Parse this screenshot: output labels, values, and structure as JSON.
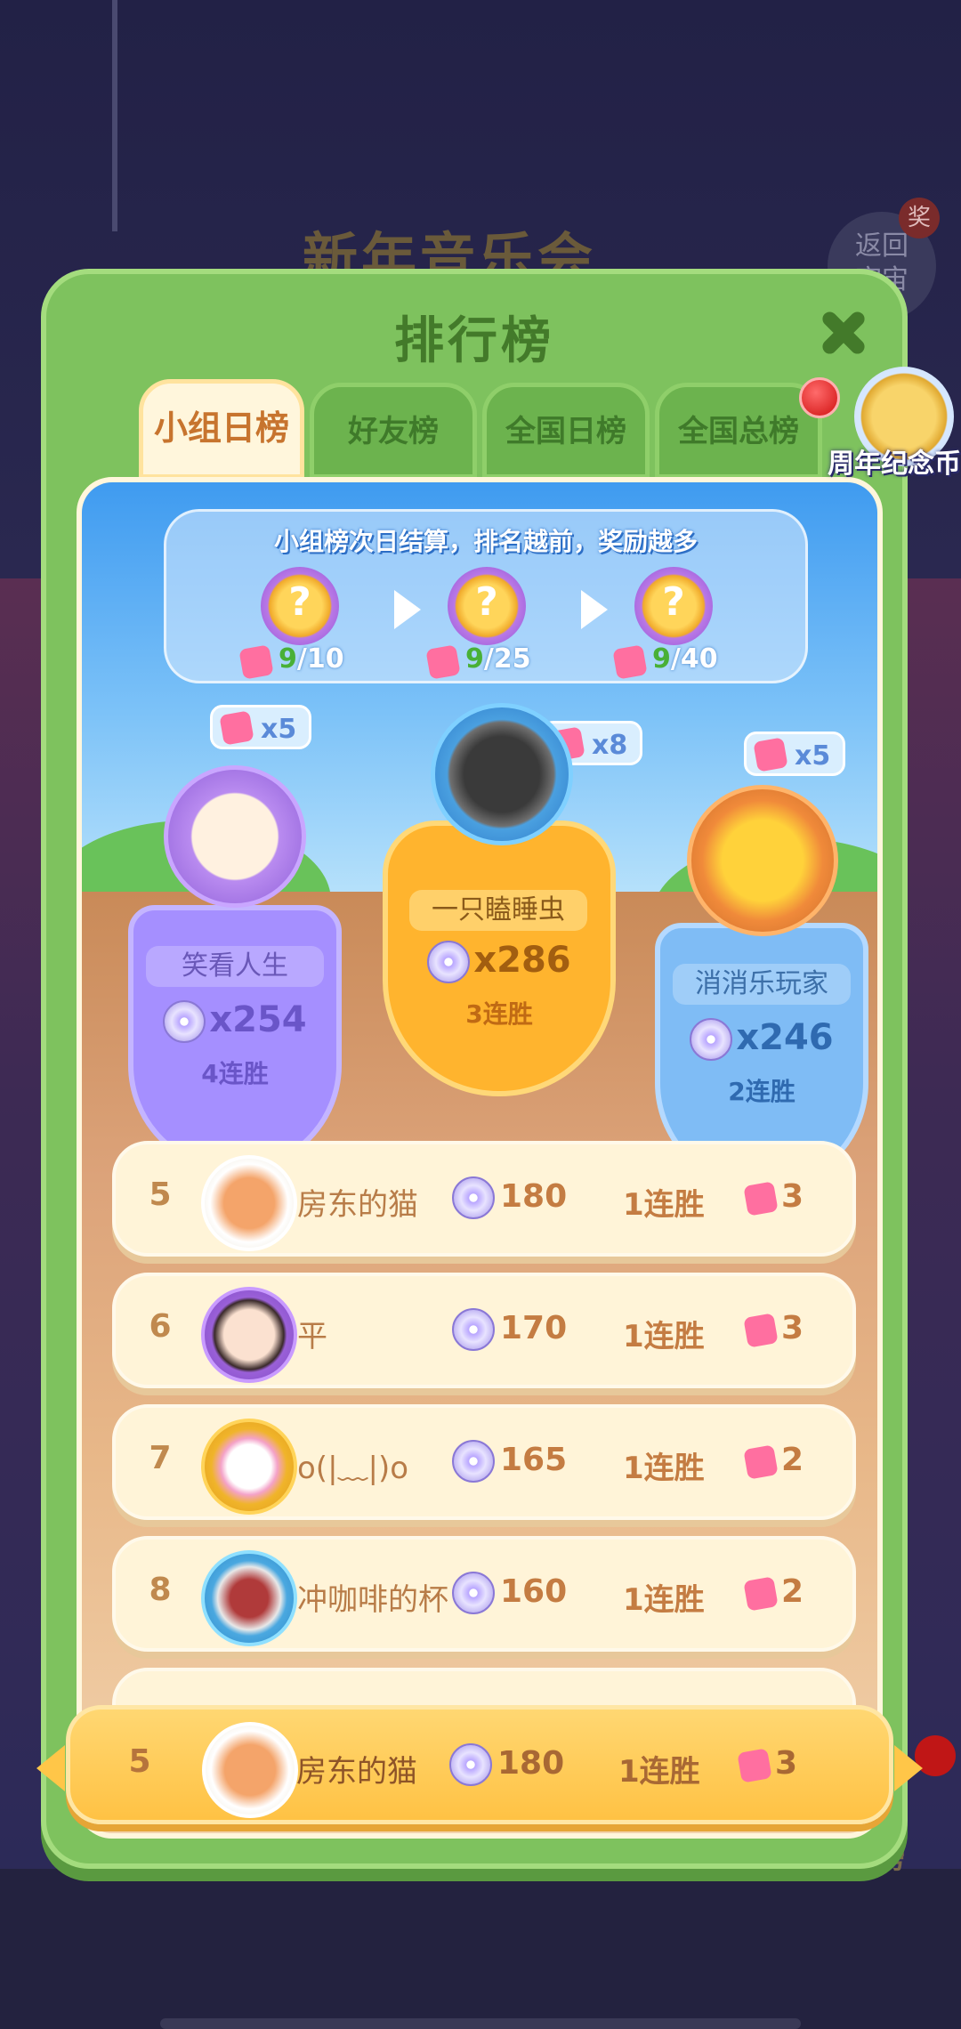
{
  "background": {
    "event_title": "新年音乐会",
    "return_label": "返回\n宇宙",
    "award_badge": "奖",
    "rank_button": "排行榜"
  },
  "panel": {
    "title": "排行榜",
    "tabs": [
      {
        "label": "小组日榜",
        "active": true
      },
      {
        "label": "好友榜",
        "active": false
      },
      {
        "label": "全国日榜",
        "active": false
      },
      {
        "label": "全国总榜",
        "active": false
      }
    ],
    "coin_label": "周年纪念币",
    "info": {
      "text": "小组榜次日结算，排名越前，奖励越多",
      "rewards": [
        {
          "icon": "mystery-reward-icon",
          "progress": "9",
          "total": "/10"
        },
        {
          "icon": "mystery-reward-icon",
          "progress": "9",
          "total": "/25"
        },
        {
          "icon": "mystery-reward-icon",
          "progress": "9",
          "total": "/40"
        }
      ]
    },
    "podium": {
      "first": {
        "name": "一只瞌睡虫",
        "score": "x286",
        "streak": "3连胜",
        "pieces": "x8"
      },
      "second": {
        "name": "笑看人生",
        "score": "x254",
        "streak": "4连胜",
        "pieces": "x5"
      },
      "third": {
        "name": "消消乐玩家",
        "score": "x246",
        "streak": "2连胜",
        "pieces": "x5"
      }
    },
    "rows": [
      {
        "rank": "5",
        "name": "房东的猫",
        "score": "180",
        "streak": "1连胜",
        "pieces": "3"
      },
      {
        "rank": "6",
        "name": "平",
        "score": "170",
        "streak": "1连胜",
        "pieces": "3"
      },
      {
        "rank": "7",
        "name": "o(|﹏|)o",
        "score": "165",
        "streak": "1连胜",
        "pieces": "2"
      },
      {
        "rank": "8",
        "name": "冲咖啡的杯",
        "score": "160",
        "streak": "1连胜",
        "pieces": "2"
      }
    ],
    "my_row": {
      "rank": "5",
      "name": "房东的猫",
      "score": "180",
      "streak": "1连胜",
      "pieces": "3"
    }
  },
  "colors": {
    "panel_green": "#7ec25e",
    "active_tab": "#fff6dc",
    "gold_row": "#ffc244",
    "text_brown": "#c47c42"
  }
}
